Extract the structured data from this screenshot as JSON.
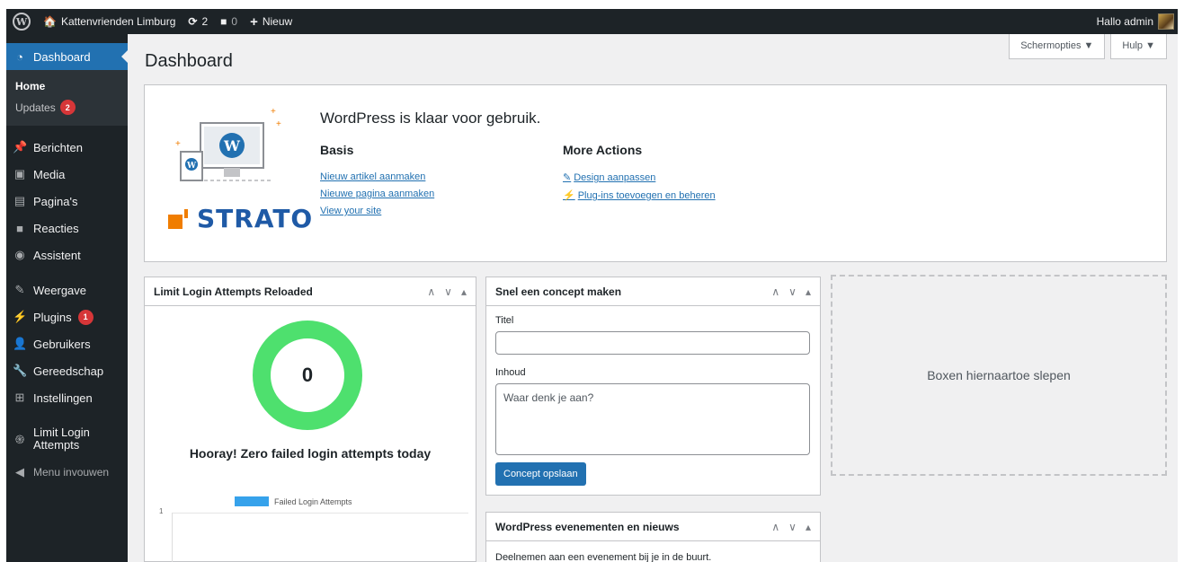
{
  "admin_bar": {
    "site_name": "Kattenvrienden Limburg",
    "updates_count": "2",
    "comments_count": "0",
    "new_label": "Nieuw",
    "greeting": "Hallo admin"
  },
  "sidebar": {
    "dashboard": "Dashboard",
    "home": "Home",
    "updates": "Updates",
    "updates_badge": "2",
    "items": [
      {
        "label": "Berichten",
        "icon": "pin-icon"
      },
      {
        "label": "Media",
        "icon": "media-icon"
      },
      {
        "label": "Pagina's",
        "icon": "page-icon"
      },
      {
        "label": "Reacties",
        "icon": "comment-icon"
      },
      {
        "label": "Assistent",
        "icon": "assistant-icon"
      },
      {
        "label": "Weergave",
        "icon": "brush-icon"
      },
      {
        "label": "Plugins",
        "icon": "plugin-icon",
        "badge": "1"
      },
      {
        "label": "Gebruikers",
        "icon": "users-icon"
      },
      {
        "label": "Gereedschap",
        "icon": "wrench-icon"
      },
      {
        "label": "Instellingen",
        "icon": "settings-icon"
      },
      {
        "label": "Limit Login Attempts",
        "icon": "fingerprint-icon"
      }
    ],
    "collapse": "Menu invouwen"
  },
  "screen_options": {
    "options": "Schermopties ▼",
    "help": "Hulp ▼"
  },
  "page_title": "Dashboard",
  "welcome": {
    "title": "WordPress is klaar voor gebruik.",
    "brand": "STRATO",
    "basis_title": "Basis",
    "basis_links": [
      "Nieuw artikel aanmaken",
      "Nieuwe pagina aanmaken",
      "View your site"
    ],
    "more_title": "More Actions",
    "more_links": [
      "Design aanpassen",
      "Plug-ins toevoegen en beheren"
    ]
  },
  "llar": {
    "title": "Limit Login Attempts Reloaded",
    "count": "0",
    "message": "Hooray! Zero failed login attempts today",
    "legend": "Failed Login Attempts",
    "axis_tick": "1"
  },
  "quick_draft": {
    "title": "Snel een concept maken",
    "title_label": "Titel",
    "content_label": "Inhoud",
    "content_placeholder": "Waar denk je aan?",
    "save": "Concept opslaan"
  },
  "events": {
    "title": "WordPress evenementen en nieuws",
    "text": "Deelnemen aan een evenement bij je in de buurt."
  },
  "dropzone": "Boxen hiernaartoe slepen",
  "colors": {
    "accent": "#2271b1",
    "adminbar": "#1d2327",
    "badge": "#d63638",
    "ring": "#4ee06e",
    "strato": "#f07d00"
  }
}
